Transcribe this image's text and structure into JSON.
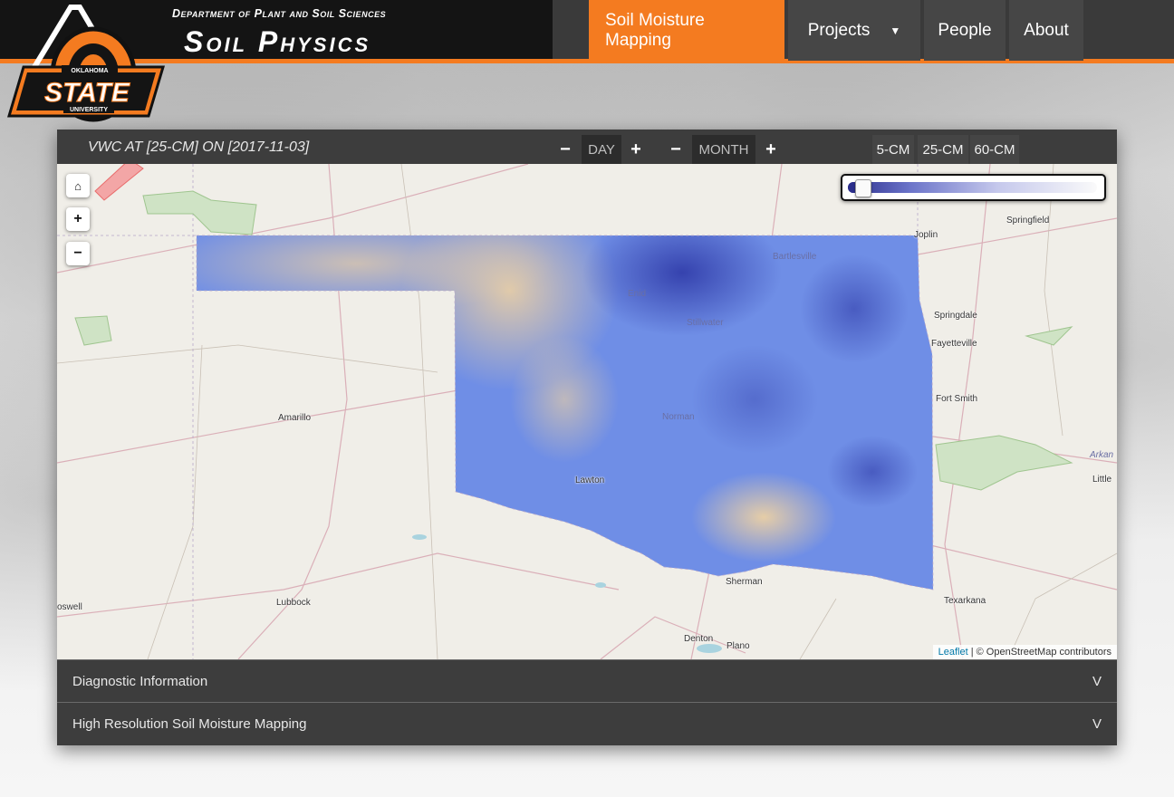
{
  "header": {
    "department": "Department of Plant and Soil Sciences",
    "unit_title": "Soil Physics",
    "logo": {
      "top_text": "OKLAHOMA",
      "main_text": "STATE",
      "bottom_text": "UNIVERSITY",
      "icon": "osu-logo"
    }
  },
  "nav": {
    "items": [
      {
        "label": "Soil Moisture Mapping",
        "active": true
      },
      {
        "label": "Projects",
        "dropdown": true,
        "caret_icon": "caret-down-icon"
      },
      {
        "label": "People"
      },
      {
        "label": "About"
      }
    ]
  },
  "toolbar": {
    "title": "VWC AT [25-CM] ON [2017-11-03]",
    "day_label": "DAY",
    "month_label": "MONTH",
    "minus_glyph": "−",
    "plus_glyph": "+",
    "depths": [
      "5-CM",
      "25-CM",
      "60-CM"
    ]
  },
  "map": {
    "controls": {
      "home_glyph": "⌂",
      "zoom_in_glyph": "+",
      "zoom_out_glyph": "−"
    },
    "cities": [
      "Springfield",
      "Joplin",
      "Bartlesville",
      "Enid",
      "Stillwater",
      "Springdale",
      "Fayetteville",
      "Fort Smith",
      "Amarillo",
      "Norman",
      "Lawton",
      "Little",
      "Arkan",
      "Sherman",
      "Texarkana",
      "Lubbock",
      "oswell",
      "Denton",
      "Plano"
    ],
    "attribution_link": "Leaflet",
    "attribution_text": " | © OpenStreetMap contributors",
    "legend_slider_value": 0.03
  },
  "accordion": {
    "items": [
      {
        "label": "Diagnostic Information",
        "chevron": "V"
      },
      {
        "label": "High Resolution Soil Moisture Mapping",
        "chevron": "V"
      }
    ]
  },
  "colors": {
    "accent": "#f47b20",
    "dark": "#3d3d3d",
    "wet": "#2b2e8c",
    "mid": "#6b8fe8",
    "dry": "#f1d5a4"
  }
}
